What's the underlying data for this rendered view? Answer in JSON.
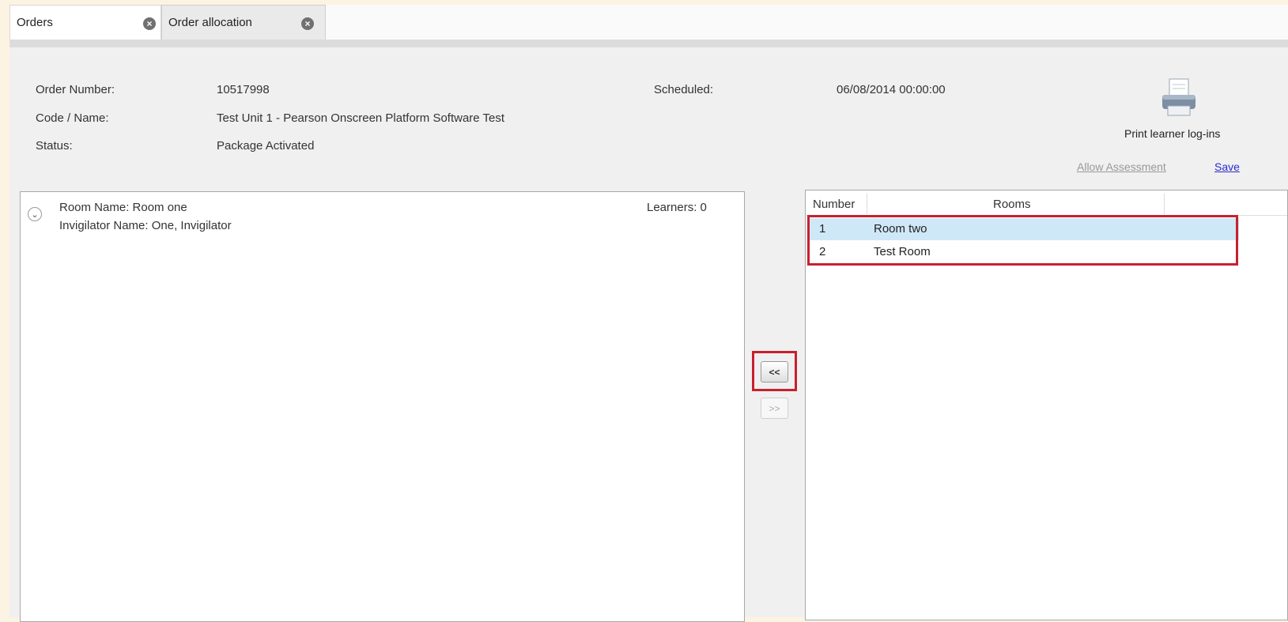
{
  "tabs": [
    {
      "label": "Orders",
      "close_icon": "close-icon"
    },
    {
      "label": "Order allocation",
      "close_icon": "close-icon"
    }
  ],
  "order": {
    "number_label": "Order Number:",
    "number_value": "10517998",
    "code_label": "Code / Name:",
    "code_value": "Test Unit 1 - Pearson Onscreen Platform Software Test",
    "status_label": "Status:",
    "status_value": "Package Activated",
    "scheduled_label": "Scheduled:",
    "scheduled_value": "06/08/2014 00:00:00"
  },
  "actions": {
    "print_icon": "printer-icon",
    "print_label": "Print learner log-ins",
    "allow_label": "Allow Assessment",
    "save_label": "Save"
  },
  "allocated_room": {
    "room_line": "Room Name: Room one",
    "invigilator_line": "Invigilator Name: One, Invigilator",
    "learners_line": "Learners: 0",
    "expand_icon": "chevron-down-icon"
  },
  "transfer": {
    "move_left_label": "<<",
    "move_right_label": ">>"
  },
  "rooms_grid": {
    "headers": [
      "Number",
      "Rooms"
    ],
    "rows": [
      {
        "number": "1",
        "room": "Room two"
      },
      {
        "number": "2",
        "room": "Test Room"
      }
    ]
  },
  "colors": {
    "highlight": "#c8202e",
    "selected_row": "#cfe8f7",
    "link": "#2a2ad0"
  }
}
